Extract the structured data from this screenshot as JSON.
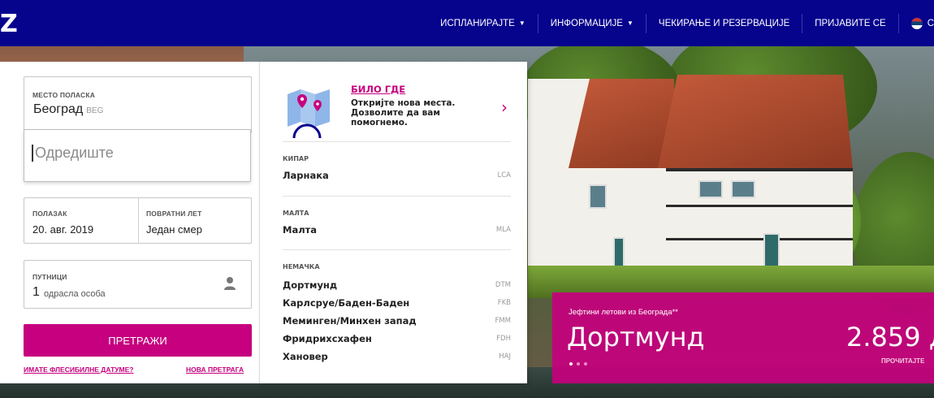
{
  "header": {
    "logo": "Z",
    "nav": [
      {
        "label": "ИСПЛАНИРАЈТЕ",
        "has_caret": true
      },
      {
        "label": "ИНФОРМАЦИЈЕ",
        "has_caret": true
      },
      {
        "label": "ЧЕКИРАЊЕ И РЕЗЕРВАЦИЈЕ",
        "has_caret": false
      },
      {
        "label": "ПРИЈАВИТЕ СЕ",
        "has_caret": false
      }
    ],
    "language_partial": "С"
  },
  "search": {
    "origin_label": "МЕСТО ПОЛАСКА",
    "origin_city": "Београд",
    "origin_code": "BEG",
    "destination_placeholder": "Одредиште",
    "departure_label": "ПОЛАЗАК",
    "departure_value": "20. авг. 2019",
    "return_label": "ПОВРАТНИ ЛЕТ",
    "return_value": "Један смер",
    "passengers_label": "ПУТНИЦИ",
    "passengers_count": "1",
    "passengers_type": "одрасла особа",
    "search_button": "ПРЕТРАЖИ",
    "flexible_dates_link": "ИМАТЕ ФЛЕСИБИЛНЕ ДАТУМЕ?",
    "new_search_link": "НОВА ПРЕТРАГА"
  },
  "dropdown": {
    "anywhere_title": "БИЛО ГДЕ",
    "anywhere_text": "Откријте нова места. Дозволите да вам помогнемо.",
    "countries": [
      {
        "country": "КИПАР",
        "cities": [
          {
            "name": "Ларнака",
            "code": "LCA"
          }
        ]
      },
      {
        "country": "МАЛТА",
        "cities": [
          {
            "name": "Малта",
            "code": "MLA"
          }
        ]
      },
      {
        "country": "НЕМАЧКА",
        "cities": [
          {
            "name": "Дортмунд",
            "code": "DTM"
          },
          {
            "name": "Карлсруе/Баден-Баден",
            "code": "FKB"
          },
          {
            "name": "Меминген/Минхен запад",
            "code": "FMM"
          },
          {
            "name": "Фридрихсхафен",
            "code": "FDH"
          },
          {
            "name": "Хановер",
            "code": "HAJ"
          }
        ]
      }
    ]
  },
  "promo": {
    "subtitle": "Јефтини летови из Београда**",
    "city": "Дортмунд",
    "price": "2.859 д",
    "read_more": "ПРОЧИТАЈТЕ"
  },
  "colors": {
    "header_bg": "#06038d",
    "accent": "#c6007e"
  }
}
